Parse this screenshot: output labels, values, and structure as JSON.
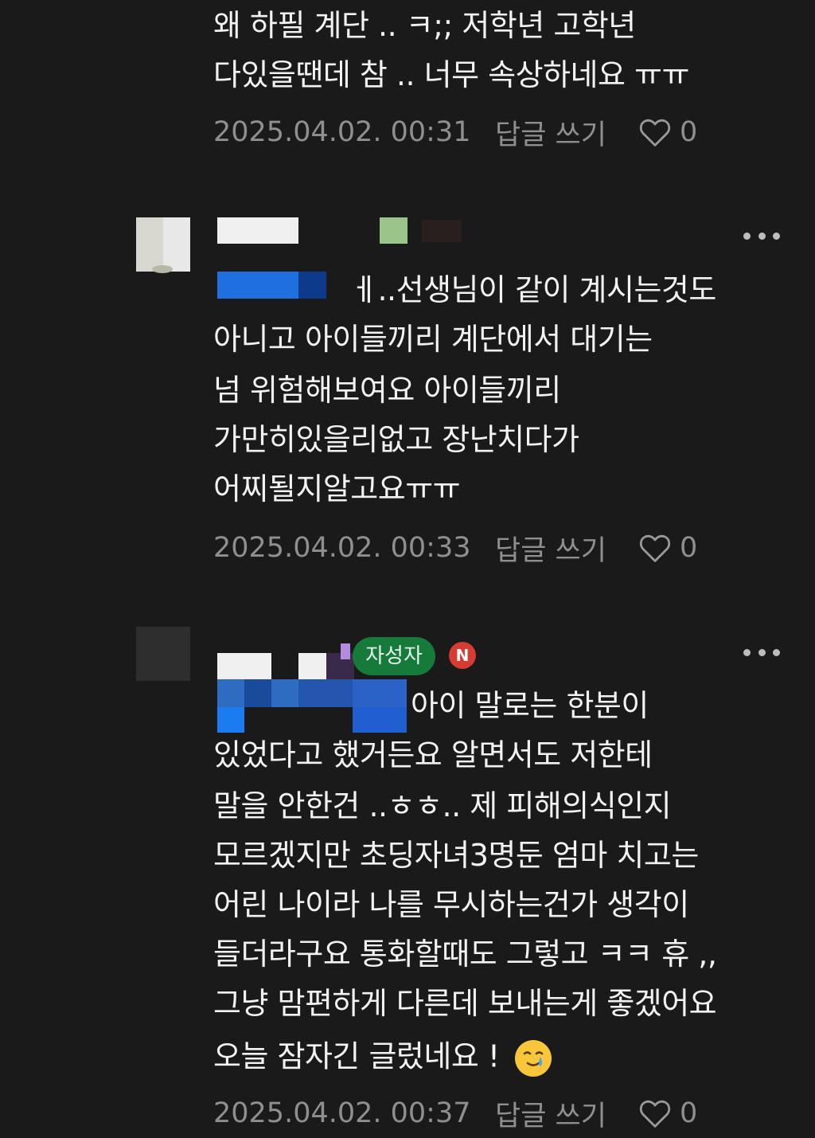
{
  "comments": [
    {
      "lines": [
        "왜 하필 계단 .. ㅋ;; 저학년 고학년",
        "다있을땐데 참 .. 너무 속상하네요 ㅠㅠ"
      ],
      "date": "2025.04.02. 00:31",
      "reply_label": "답글 쓰기",
      "likes": "0"
    },
    {
      "lines": [
        "ㅔ..선생님이 같이 계시는것도",
        "아니고 아이들끼리 계단에서 대기는",
        "넘 위험해보여요 아이들끼리",
        "가만히있을리없고 장난치다가",
        "어찌될지알고요ㅠㅠ"
      ],
      "date": "2025.04.02. 00:33",
      "reply_label": "답글 쓰기",
      "likes": "0"
    },
    {
      "writer_badge": "자성자",
      "new_badge": "N",
      "lines": [
        "아이 말로는 한분이",
        "있었다고 했거든요 알면서도 저한테",
        "말을 안한건 ..ㅎㅎ.. 제 피해의식인지",
        "모르겠지만 초딩자녀3명둔 엄마 치고는",
        "어린 나이라 나를 무시하는건가 생각이",
        "들더라구요 통화할때도 그렇고 ㅋㅋ 휴 ,,",
        "그냥 맘편하게 다른데 보내는게 좋겠어요",
        "오늘 잠자긴 글렀네요 !"
      ],
      "emoji": "crying-smile-emoji",
      "date": "2025.04.02. 00:37",
      "reply_label": "답글 쓰기",
      "likes": "0"
    }
  ],
  "colors": {
    "background": "#1a1a1a",
    "text": "#f2f2f2",
    "meta": "#8f8f8f",
    "writer_badge": "#157a3a",
    "new_badge": "#d63b34"
  }
}
